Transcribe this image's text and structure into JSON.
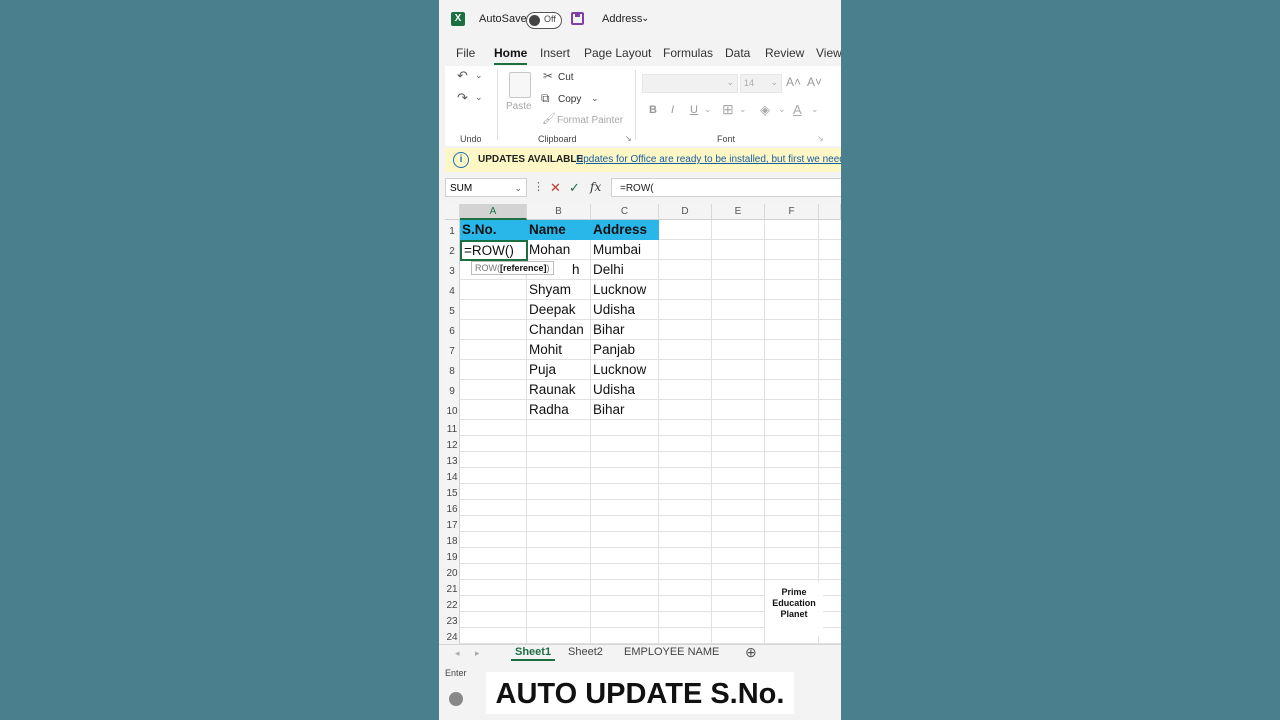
{
  "titlebar": {
    "autosave_label": "AutoSave",
    "autosave_state": "Off",
    "file_name": "Address"
  },
  "tabs": [
    "File",
    "Home",
    "Insert",
    "Page Layout",
    "Formulas",
    "Data",
    "Review",
    "View"
  ],
  "ribbon": {
    "undo_label": "Undo",
    "clipboard": {
      "paste": "Paste",
      "cut": "Cut",
      "copy": "Copy",
      "format_painter": "Format Painter",
      "label": "Clipboard"
    },
    "font": {
      "size": "14",
      "label": "Font"
    }
  },
  "update_bar": {
    "title": "UPDATES AVAILABLE",
    "message": "Updates for Office are ready to be installed, but first we need"
  },
  "formula_bar": {
    "name_box": "SUM",
    "fx": "fx",
    "formula": "=ROW("
  },
  "grid": {
    "columns": [
      "A",
      "B",
      "C",
      "D",
      "E",
      "F"
    ],
    "rows": [
      "1",
      "2",
      "3",
      "4",
      "5",
      "6",
      "7",
      "8",
      "9",
      "10",
      "11",
      "12",
      "13",
      "14",
      "15",
      "16",
      "17",
      "18",
      "19",
      "20",
      "21",
      "22",
      "23",
      "24"
    ],
    "headers": {
      "a": "S.No.",
      "b": "Name",
      "c": "Address"
    },
    "active_cell_text": "=ROW()",
    "tooltip_fn": "ROW(",
    "tooltip_arg": "[reference]",
    "tooltip_close": ")",
    "data": [
      {
        "name": "Mohan",
        "address": "Mumbai"
      },
      {
        "name": "h",
        "address": "Delhi"
      },
      {
        "name": "Shyam",
        "address": "Lucknow"
      },
      {
        "name": "Deepak",
        "address": "Udisha"
      },
      {
        "name": "Chandan",
        "address": "Bihar"
      },
      {
        "name": "Mohit",
        "address": "Panjab"
      },
      {
        "name": "Puja",
        "address": "Lucknow"
      },
      {
        "name": "Raunak",
        "address": "Udisha"
      },
      {
        "name": "Radha",
        "address": "Bihar"
      }
    ]
  },
  "watermark": {
    "line1": "Prime",
    "line2": "Education",
    "line3": "Planet"
  },
  "sheets": [
    "Sheet1",
    "Sheet2",
    "EMPLOYEE NAME"
  ],
  "status": {
    "mode": "Enter"
  },
  "caption": "AUTO UPDATE S.No.",
  "colors": {
    "excel_green": "#1d6f42",
    "header_fill": "#29b6e8",
    "background": "#4a7f8e"
  }
}
